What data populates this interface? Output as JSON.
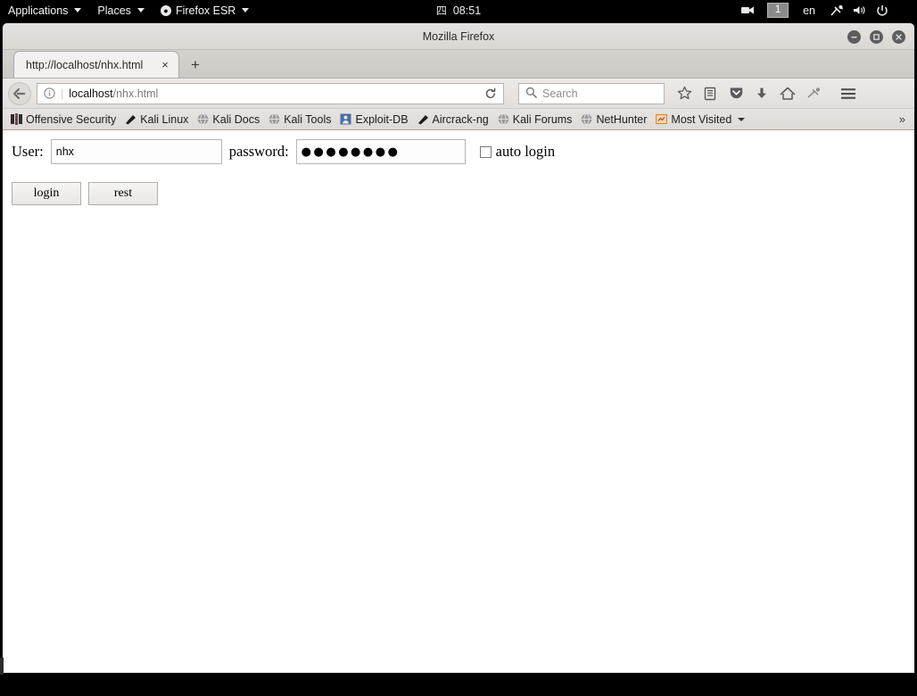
{
  "desktop": {
    "panel": {
      "applications_label": "Applications",
      "places_label": "Places",
      "firefox_label": "Firefox ESR",
      "clock_glyph": "四",
      "clock_time": "08:51",
      "workspace": "1",
      "language": "en",
      "icons": [
        "video-camera-icon",
        "network-tools-icon",
        "volume-icon",
        "power-icon"
      ]
    }
  },
  "browser": {
    "window_title": "Mozilla Firefox",
    "window_buttons": [
      "minimize",
      "maximize",
      "close"
    ],
    "tab": {
      "title": "http://localhost/nhx.html",
      "close_label": "×",
      "newtab_label": "+"
    },
    "navbar": {
      "back_label": "←",
      "url_host": "localhost",
      "url_path": "/nhx.html",
      "reload_label": "↻",
      "search_placeholder": "Search",
      "icons": [
        "star-icon",
        "library-icon",
        "pocket-icon",
        "downloads-icon",
        "home-icon",
        "sync-icon",
        "hamburger-menu-icon"
      ]
    },
    "bookmarks": {
      "items": [
        {
          "label": "Offensive Security",
          "icon": "offensive-security-icon"
        },
        {
          "label": "Kali Linux",
          "icon": "kali-linux-icon"
        },
        {
          "label": "Kali Docs",
          "icon": "globe-icon"
        },
        {
          "label": "Kali Tools",
          "icon": "globe-icon"
        },
        {
          "label": "Exploit-DB",
          "icon": "exploit-db-icon"
        },
        {
          "label": "Aircrack-ng",
          "icon": "aircrack-icon"
        },
        {
          "label": "Kali Forums",
          "icon": "globe-icon"
        },
        {
          "label": "NetHunter",
          "icon": "globe-icon"
        },
        {
          "label": "Most Visited",
          "icon": "most-visited-icon",
          "has_caret": true
        }
      ],
      "overflow_label": "»"
    }
  },
  "page": {
    "user_label": "User:",
    "user_value": "nhx",
    "password_label": "password:",
    "password_masked": "●●●●●●●●",
    "autologin_label": "auto login",
    "autologin_checked": false,
    "login_button": "login",
    "reset_button": "rest"
  },
  "colors": {
    "panel_bg": "#000000",
    "chrome_bg": "#e2dfdc",
    "content_bg": "#ffffff",
    "workspace_badge": "#8a8a8a",
    "exploit_db_accent": "#4a6fa5",
    "most_visited_accent": "#e08a2e"
  }
}
